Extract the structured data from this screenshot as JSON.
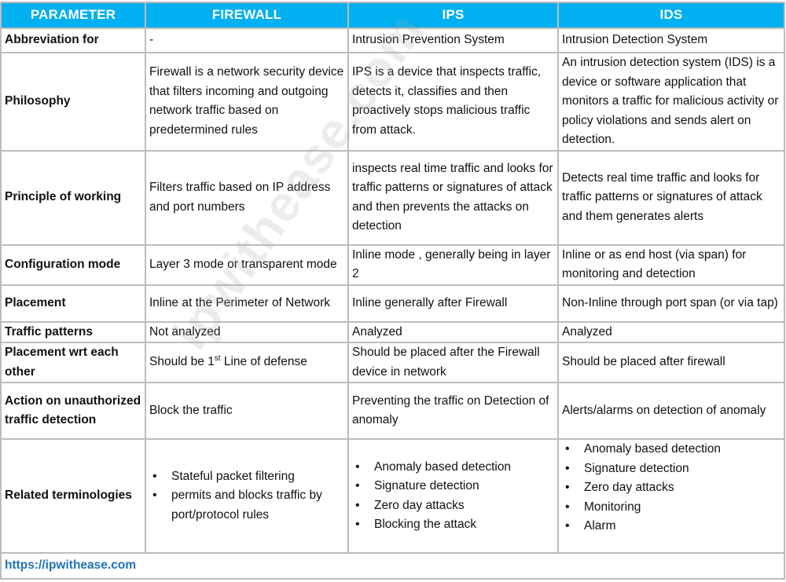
{
  "table": {
    "headers": [
      "PARAMETER",
      "FIREWALL",
      "IPS",
      "IDS"
    ],
    "rows": {
      "abbreviation": {
        "param": "Abbreviation for",
        "firewall": "-",
        "ips": "Intrusion Prevention System",
        "ids": "Intrusion Detection System"
      },
      "philosophy": {
        "param": "Philosophy",
        "firewall": "Firewall is a network security device that filters incoming and outgoing network traffic based on predetermined rules",
        "ips": "IPS is a device that inspects traffic, detects it, classifies and then proactively stops malicious traffic from attack.",
        "ids": "An intrusion detection system (IDS) is a device or software application that monitors a traffic for malicious activity or policy violations and sends alert on detection."
      },
      "principle": {
        "param": "Principle of working",
        "firewall": "Filters traffic based on IP address and port numbers",
        "ips": "inspects real time traffic and looks for traffic patterns or signatures of attack and then prevents the attacks on detection",
        "ids": "Detects real time traffic and looks for traffic patterns or signatures of attack and them generates alerts"
      },
      "configuration": {
        "param": "Configuration mode",
        "firewall": "Layer 3 mode or transparent mode",
        "ips": "Inline mode , generally being in layer 2",
        "ids": "Inline or as end host (via span) for monitoring and detection"
      },
      "placement": {
        "param": "Placement",
        "firewall": "Inline at the Perimeter of Network",
        "ips": "Inline generally after Firewall",
        "ids": "Non-Inline through port span (or via tap)"
      },
      "traffic_patterns": {
        "param": "Traffic patterns",
        "firewall": "Not analyzed",
        "ips": "Analyzed",
        "ids": "Analyzed"
      },
      "placement_wrt": {
        "param": "Placement wrt each other",
        "firewall_pre": "Should be 1",
        "firewall_sup": "st",
        "firewall_post": " Line of defense",
        "ips": "Should be placed after the Firewall device in network",
        "ids": "Should be placed after firewall"
      },
      "action": {
        "param": "Action on unauthorized traffic detection",
        "firewall": "Block the traffic",
        "ips": "Preventing the traffic on Detection of anomaly",
        "ids": "Alerts/alarms on detection of anomaly"
      },
      "terminologies": {
        "param": "Related terminologies",
        "firewall": [
          "Stateful packet filtering",
          "permits and blocks traffic by port/protocol rules"
        ],
        "ips": [
          "Anomaly based detection",
          "Signature detection",
          "Zero day attacks",
          "Blocking the attack"
        ],
        "ids": [
          "Anomaly based detection",
          "Signature detection",
          "Zero day attacks",
          "Monitoring",
          "Alarm"
        ]
      }
    },
    "footer_url": "https://ipwithease.com"
  },
  "watermark": "ipwithease.com",
  "colors": {
    "header_bg": "#00b0f0",
    "header_text": "#ffffff",
    "border": "#bdbdbd",
    "footer_link": "#1f72b8"
  }
}
